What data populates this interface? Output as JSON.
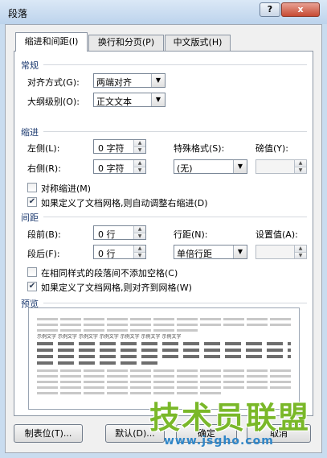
{
  "window": {
    "title": "段落",
    "help_label": "?",
    "close_label": "x"
  },
  "tabs": [
    {
      "label": "缩进和间距(I)",
      "active": true
    },
    {
      "label": "换行和分页(P)",
      "active": false
    },
    {
      "label": "中文版式(H)",
      "active": false
    }
  ],
  "general": {
    "title": "常规",
    "alignment_label": "对齐方式(G):",
    "alignment_value": "两端对齐",
    "outline_label": "大纲级别(O):",
    "outline_value": "正文文本"
  },
  "indent": {
    "title": "缩进",
    "left_label": "左侧(L):",
    "left_value": "0 字符",
    "right_label": "右侧(R):",
    "right_value": "0 字符",
    "special_label": "特殊格式(S):",
    "special_value": "(无)",
    "by_label": "磅值(Y):",
    "mirror_label": "对称缩进(M)",
    "mirror_checked": false,
    "auto_adjust_label": "如果定义了文档网格,则自动调整右缩进(D)",
    "auto_adjust_checked": true
  },
  "spacing": {
    "title": "间距",
    "before_label": "段前(B):",
    "before_value": "0 行",
    "after_label": "段后(F):",
    "after_value": "0 行",
    "line_label": "行距(N):",
    "line_value": "单倍行距",
    "at_label": "设置值(A):",
    "no_space_label": "在相同样式的段落间不添加空格(C)",
    "no_space_checked": false,
    "snap_grid_label": "如果定义了文档网格,则对齐到网格(W)",
    "snap_grid_checked": true
  },
  "preview": {
    "title": "预览",
    "sample_text": "示例文字 示例文字 示例文字 示例文字 示例文字 示例文字 示例文字"
  },
  "buttons": {
    "tabs_label": "制表位(T)...",
    "default_label": "默认(D)...",
    "ok_label": "确定",
    "cancel_label": "取消"
  },
  "watermark": {
    "text": "技术员联盟",
    "url": "www.jsgho.com"
  }
}
